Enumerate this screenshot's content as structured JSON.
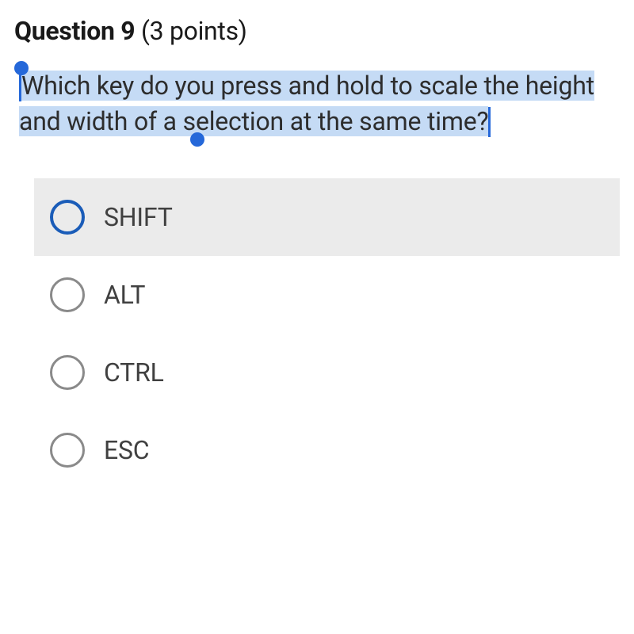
{
  "header": {
    "question_label": "Question 9",
    "points_label": "(3 points)"
  },
  "question": {
    "text": "Which key do you press and hold to scale the height and width of a selection at the same time?"
  },
  "options": [
    {
      "label": "SHIFT",
      "highlighted": true
    },
    {
      "label": "ALT",
      "highlighted": false
    },
    {
      "label": "CTRL",
      "highlighted": false
    },
    {
      "label": "ESC",
      "highlighted": false
    }
  ]
}
